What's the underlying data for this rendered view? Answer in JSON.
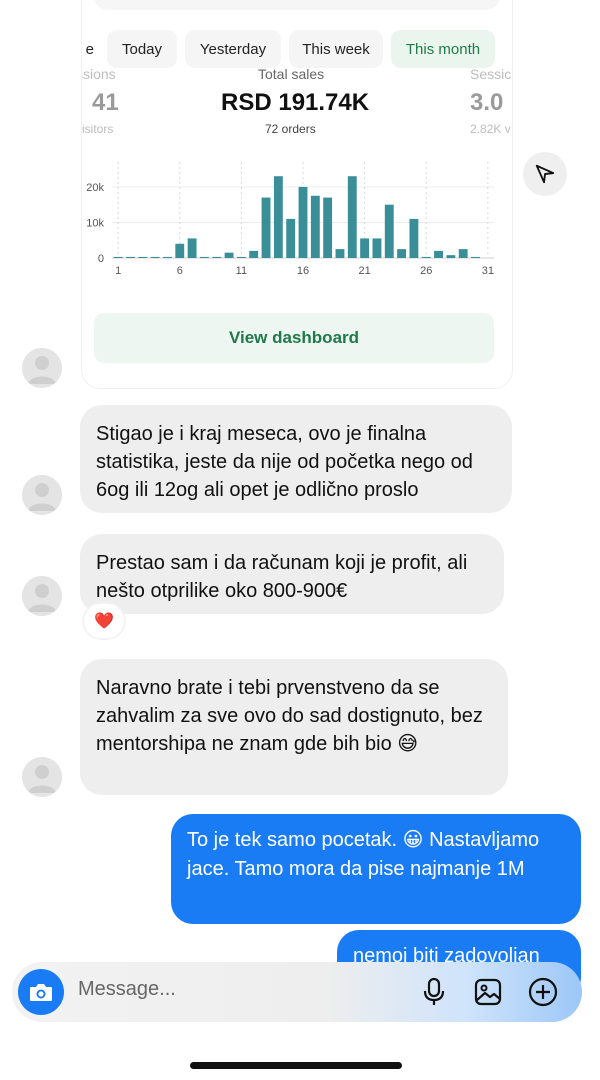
{
  "tabs": [
    {
      "label": "e"
    },
    {
      "label": "Today"
    },
    {
      "label": "Yesterday"
    },
    {
      "label": "This week"
    },
    {
      "label": "This month",
      "active": true
    }
  ],
  "stats": {
    "left": {
      "label": "ssions",
      "value": "41",
      "sub": "visitors"
    },
    "center": {
      "label": "Total sales",
      "value": "RSD 191.74K",
      "sub": "72 orders"
    },
    "right": {
      "label": "Sessic",
      "value": "3.0",
      "sub": "2.82K v"
    }
  },
  "chart_data": {
    "type": "bar",
    "title": "",
    "xlabel": "",
    "ylabel": "",
    "x": [
      1,
      2,
      3,
      4,
      5,
      6,
      7,
      8,
      9,
      10,
      11,
      12,
      13,
      14,
      15,
      16,
      17,
      18,
      19,
      20,
      21,
      22,
      23,
      24,
      25,
      26,
      27,
      28,
      29,
      30,
      31
    ],
    "values": [
      300,
      300,
      300,
      300,
      300,
      4000,
      5500,
      300,
      300,
      1500,
      300,
      2000,
      17000,
      23000,
      11000,
      20000,
      17500,
      17000,
      2500,
      23000,
      5500,
      5500,
      15000,
      2500,
      11000,
      300,
      2000,
      800,
      2500,
      300,
      0
    ],
    "ylim": [
      0,
      27000
    ],
    "y_ticks": [
      "0",
      "10k",
      "20k"
    ],
    "x_ticks": [
      "1",
      "6",
      "11",
      "16",
      "21",
      "26",
      "31"
    ],
    "color": "#3a8e98",
    "grid": true
  },
  "card": {
    "view_dashboard": "View dashboard"
  },
  "messages": {
    "m1": "Stigao je i kraj meseca, ovo je finalna statistika, jeste da nije od početka nego od 6og ili 12og ali opet je odlično proslo",
    "m2": "Prestao sam i da računam koji je profit, ali nešto otprilike oko 800-900€",
    "m2_reaction": "❤️",
    "m3": "Naravno brate i tebi prvenstveno da se zahvalim za sve ovo do sad dostignuto, bez mentorshipa ne znam gde bih bio 😅",
    "m4": "To je tek samo pocetak. 😀 Nastavljamo jace. Tamo mora da pise najmanje 1M",
    "m5": "nemoj biti zadovoljan"
  },
  "composer": {
    "placeholder": "Message..."
  },
  "colors": {
    "bubble_out": "#1a7cf5",
    "bubble_in": "#eeeeee",
    "accent_green": "#1e7a4a",
    "bar": "#3a8e98"
  },
  "icons": [
    "share-icon",
    "camera-icon",
    "microphone-icon",
    "gallery-icon",
    "add-icon",
    "avatar-icon"
  ]
}
